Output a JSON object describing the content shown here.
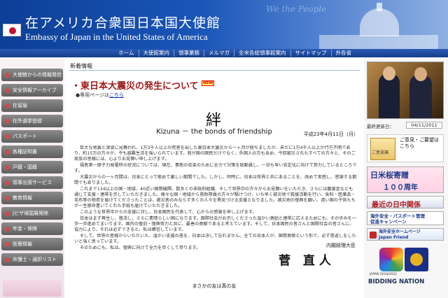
{
  "header": {
    "title_jp": "在アメリカ合衆国日本国大使館",
    "title_en": "Embassy of Japan in the United States of America"
  },
  "nav": {
    "items": [
      "ホーム",
      "大使館案内",
      "領事業務",
      "メルマガ",
      "全米各総領事館案内",
      "サイトマップ",
      "外各省"
    ]
  },
  "sidebar": {
    "items": [
      "大使館からの情報発信",
      "安全情報アーカイブ",
      "在留届",
      "在外選挙登録",
      "パスポート",
      "各種証明書",
      "戸籍・国籍",
      "領事出張サービス",
      "教育情報",
      "Jビザ帰国展発除",
      "年金・保険",
      "医療情報",
      "弁護士・通訳リスト"
    ]
  },
  "main": {
    "section_label": "新着情報",
    "headline": "・東日本大震災の発生について",
    "new_badge": "NEW",
    "special_page_prefix": "●専用ページは",
    "special_page_link": "こちら",
    "kanji": "絆",
    "kizuna": "Kizuna － the bonds of friendship",
    "date": "平成23年4月11日（月）",
    "paragraphs": [
      "巨大な地震と津波に見舞われ、1万3千人以上の死者を出した東日本大震災から一ヶ月が経ちましたが、未だに1万4千人以上が行方不明であり、約15万の方々が、今も避難生活を強いられています。我が国の国民だけでなく、外国人の方も含め、今回被災されたすべての方々と、そのご家族の皆様には、心よりお見舞い申し上げます。",
      "福島第一原子力発電所の状況については、現在、事態の収束のために全力で対策を総動員し、一日も早い安定化に向けて努力しているところです。",
      "大震災からの一ヶ月間は、日本にとって極めて厳しい期間でした。しかし、同時に、日本は世界と共にあることを、改めて実感し、感謝する期間でもありました。",
      "これまで134以上の国・地域、40近い国際機関、数多くの非政府組織、そして世界中の方々からお見舞いをいただき、さらには義援金なども通じて支援・連帯を示していただきました。様々な国・地域から救助隊員の方々が駆けつけ、いち早く被災地で救援活動を行い、食料・医薬品・毛布等の物資を届けてくださったことは、被災者のみならず多くの人々を勇気づける支援となりました。被災地の復興を願い、遠い国の子供たちが一生懸命書いてくれた手紙も届けていただきました。",
      "このような世界中からの支援に対し、日本国民を代表して、心からの感謝を申し上げます。",
      "日本はまず再生し、復活し、さらに素晴らしい国になります。国際社会がお示しくださった温かい激励と連帯に応えるためにも、その歩みを一歩一歩進めてまいります。国内の復旧・復興努力と共に、最善の貢献であると考えています。そして、日本国民の皆さんと国際社会の皆さんに、協力により、それは必ずできると、私は確信しています。",
      "そして、世界の皆様からいただいた、温かい支援の恩を、日本は決して忘れません。全ての日本人が、国際貢献という形で、必ず恩返しをしたいと強く思っています。",
      "そのためにも、私は、復興に向けて全力を尽くして参ります。"
    ],
    "pm_title": "内閣総理大臣",
    "signature": "菅 直人",
    "closing": "まさかの友は真の友"
  },
  "right": {
    "updated_label": "最終更新日：",
    "updated_value": "04/11/2011",
    "opinion_text": "ご意見・ご要望はこちら",
    "opinion_mail_label": "ご意見箱",
    "sakura_line1": "日米桜寄贈",
    "sakura_line2": "１００周年",
    "relations": "最近の日中関係",
    "passport_line1": "海外安全・パスポート管理",
    "passport_line2": "促進キャンペーン",
    "friend_line1": "海外安全ホームページ",
    "friend_line2": "Japan Friend",
    "japan_logo_label": "JAPAN 2018/2022",
    "bidding": "BIDDING NATION"
  }
}
